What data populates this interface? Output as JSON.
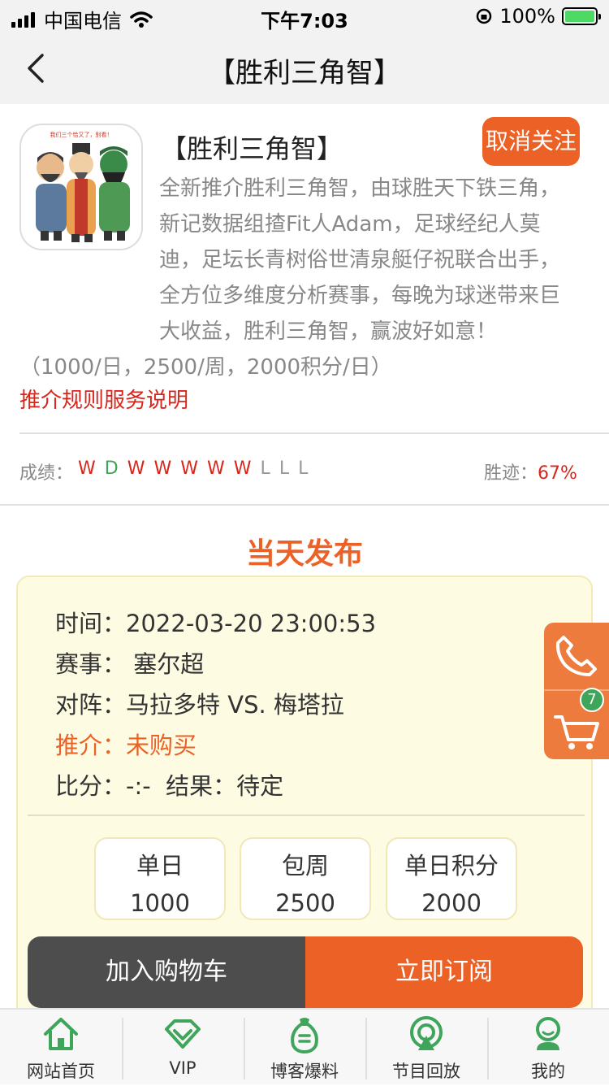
{
  "status_bar": {
    "carrier": "中国电信",
    "time": "下午7:03",
    "battery": "100%"
  },
  "nav": {
    "title": "【胜利三角智】"
  },
  "profile": {
    "name": "【胜利三角智】",
    "follow_label": "取消关注",
    "avatar_caption": "我们三个恰又了，别看！",
    "description": "全新推介胜利三角智，由球胜天下铁三角，新记数据组揸Fit人Adam，足球经纪人莫迪，足坛长青树俗世清泉艇仔祝联合出手，全方位多维度分析赛事，每晚为球迷带来巨大收益，胜利三角智，赢波好如意！",
    "pricing_note": "（1000/日，2500/周，2000积分/日）",
    "rules_link": "推介规则服务说明"
  },
  "record": {
    "label": "成绩：",
    "results": [
      {
        "r": "W",
        "color": "#d9261c"
      },
      {
        "r": "D",
        "color": "#3ea55a"
      },
      {
        "r": "W",
        "color": "#d9261c"
      },
      {
        "r": "W",
        "color": "#d9261c"
      },
      {
        "r": "W",
        "color": "#d9261c"
      },
      {
        "r": "W",
        "color": "#d9261c"
      },
      {
        "r": "W",
        "color": "#d9261c"
      },
      {
        "r": "L",
        "color": "#999999"
      },
      {
        "r": "L",
        "color": "#999999"
      },
      {
        "r": "L",
        "color": "#999999"
      }
    ],
    "win_label": "胜迹：",
    "win_rate": "67%"
  },
  "section_title": "当天发布",
  "match": {
    "time_label": "时间：",
    "time_value": "2022-03-20 23:00:53",
    "event_label": "赛事：",
    "event_value": "塞尔超",
    "teams_label": "对阵：",
    "teams_value": "马拉多特 VS. 梅塔拉",
    "tip_label": "推介：",
    "tip_value": "未购买",
    "score_label": "比分：",
    "score_value": "-:-",
    "result_label": "结果：",
    "result_value": "待定"
  },
  "prices": [
    {
      "label": "单日",
      "value": "1000"
    },
    {
      "label": "包周",
      "value": "2500"
    },
    {
      "label": "单日积分",
      "value": "2000"
    }
  ],
  "actions": {
    "add_cart": "加入购物车",
    "subscribe": "立即订阅"
  },
  "side": {
    "cart_count": "7"
  },
  "tabs": [
    {
      "label": "网站首页",
      "icon": "home-icon"
    },
    {
      "label": "VIP",
      "icon": "vip-diamond-icon"
    },
    {
      "label": "博客爆料",
      "icon": "blog-bag-icon"
    },
    {
      "label": "节目回放",
      "icon": "replay-icon"
    },
    {
      "label": "我的",
      "icon": "profile-icon"
    }
  ],
  "colors": {
    "accent": "#ec6126",
    "green": "#3ea55a",
    "card_bg": "#fefbe3"
  }
}
